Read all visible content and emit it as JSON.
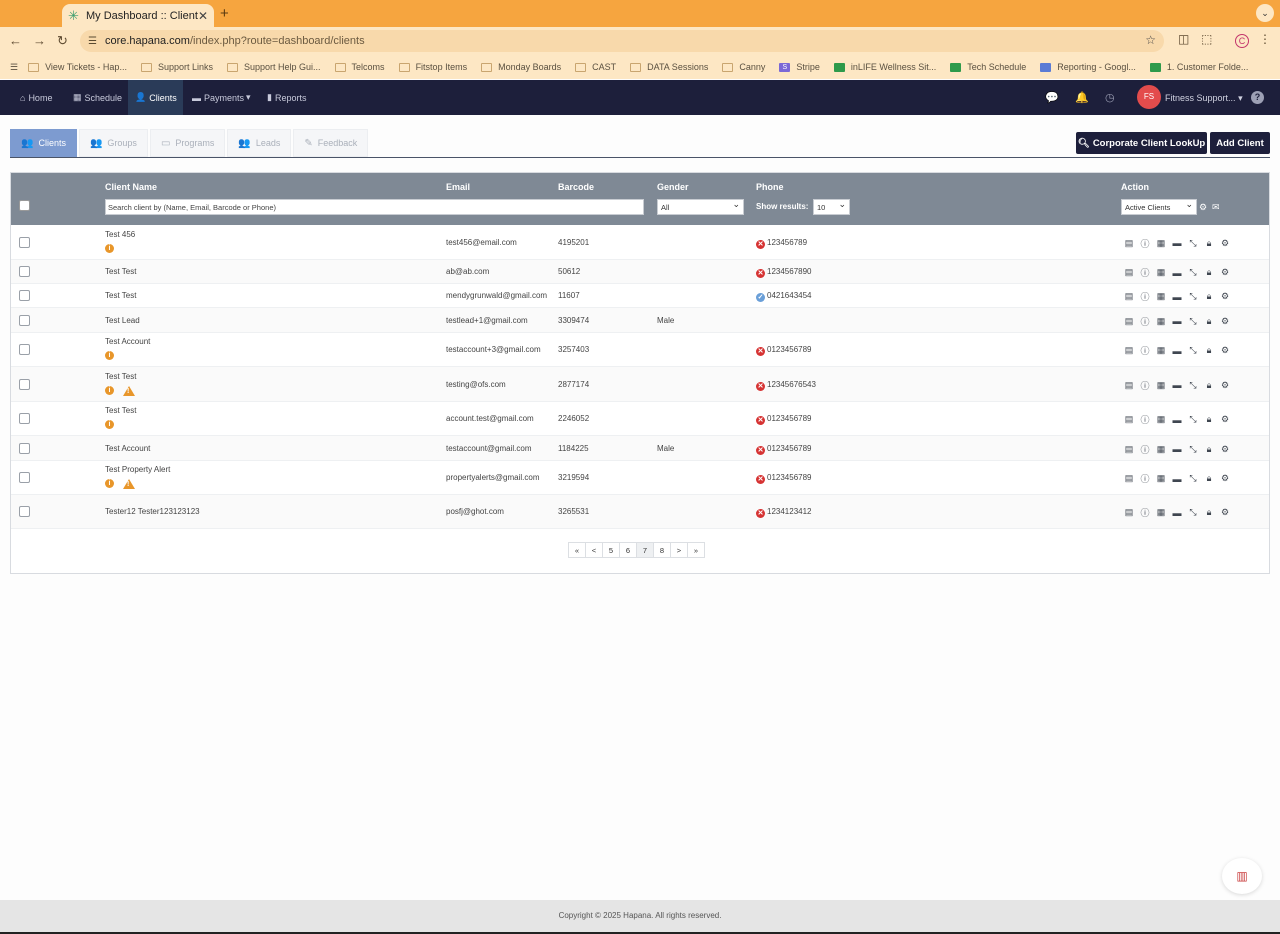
{
  "browser": {
    "tab_title": "My Dashboard :: Clients",
    "url_host": "core.hapana.com",
    "url_path": "/index.php?route=dashboard/clients",
    "profile_initial": "C"
  },
  "bookmarks": [
    {
      "label": "View Tickets - Hap...",
      "icon": "folder"
    },
    {
      "label": "Support Links",
      "icon": "folder"
    },
    {
      "label": "Support Help Gui...",
      "icon": "folder"
    },
    {
      "label": "Telcoms",
      "icon": "folder"
    },
    {
      "label": "Fitstop Items",
      "icon": "folder"
    },
    {
      "label": "Monday Boards",
      "icon": "folder"
    },
    {
      "label": "CAST",
      "icon": "folder"
    },
    {
      "label": "DATA Sessions",
      "icon": "folder"
    },
    {
      "label": "Canny",
      "icon": "folder"
    },
    {
      "label": "Stripe",
      "icon": "stripe"
    },
    {
      "label": "inLIFE Wellness Sit...",
      "icon": "sheets"
    },
    {
      "label": "Tech Schedule",
      "icon": "sheets"
    },
    {
      "label": "Reporting - Googl...",
      "icon": "docs"
    },
    {
      "label": "1. Customer Folde...",
      "icon": "drive"
    }
  ],
  "nav": {
    "home": "Home",
    "schedule": "Schedule",
    "clients": "Clients",
    "payments": "Payments",
    "reports": "Reports",
    "avatar_initials": "FS",
    "user_name": "Fitness Support..."
  },
  "subtabs": {
    "clients": "Clients",
    "groups": "Groups",
    "programs": "Programs",
    "leads": "Leads",
    "feedback": "Feedback"
  },
  "buttons": {
    "corporate_lookup": "Corporate Client LookUp",
    "add_client": "Add Client"
  },
  "table": {
    "headers": {
      "client_name": "Client Name",
      "email": "Email",
      "barcode": "Barcode",
      "gender": "Gender",
      "phone": "Phone",
      "action": "Action"
    },
    "search_placeholder": "Search client by (Name, Email, Barcode or Phone)",
    "gender_filter": "All",
    "show_results_label": "Show results:",
    "show_results_value": "10",
    "status_filter": "Active Clients",
    "rows": [
      {
        "name": "Test 456",
        "email": "test456@email.com",
        "barcode": "4195201",
        "gender": "",
        "phone": "123456789",
        "phone_status": "invalid",
        "info": true,
        "warn": false
      },
      {
        "name": "Test Test",
        "email": "ab@ab.com",
        "barcode": "50612",
        "gender": "",
        "phone": "1234567890",
        "phone_status": "invalid",
        "info": false,
        "warn": false
      },
      {
        "name": "Test Test",
        "email": "mendygrunwald@gmail.com",
        "barcode": "11607",
        "gender": "",
        "phone": "0421643454",
        "phone_status": "valid",
        "info": false,
        "warn": false
      },
      {
        "name": "Test Lead",
        "email": "testlead+1@gmail.com",
        "barcode": "3309474",
        "gender": "Male",
        "phone": "",
        "phone_status": "none",
        "info": false,
        "warn": false
      },
      {
        "name": "Test Account",
        "email": "testaccount+3@gmail.com",
        "barcode": "3257403",
        "gender": "",
        "phone": "0123456789",
        "phone_status": "invalid",
        "info": true,
        "warn": false
      },
      {
        "name": "Test Test",
        "email": "testing@ofs.com",
        "barcode": "2877174",
        "gender": "",
        "phone": "12345676543",
        "phone_status": "invalid",
        "info": true,
        "warn": true
      },
      {
        "name": "Test Test",
        "email": "account.test@gmail.com",
        "barcode": "2246052",
        "gender": "",
        "phone": "0123456789",
        "phone_status": "invalid",
        "info": true,
        "warn": false
      },
      {
        "name": "Test Account",
        "email": "testaccount@gmail.com",
        "barcode": "1184225",
        "gender": "Male",
        "phone": "0123456789",
        "phone_status": "invalid",
        "info": false,
        "warn": false
      },
      {
        "name": "Test Property Alert",
        "email": "propertyalerts@gmail.com",
        "barcode": "3219594",
        "gender": "",
        "phone": "0123456789",
        "phone_status": "invalid",
        "info": true,
        "warn": true
      },
      {
        "name": "Tester12 Tester123123123",
        "email": "posfj@ghot.com",
        "barcode": "3265531",
        "gender": "",
        "phone": "1234123412",
        "phone_status": "invalid",
        "info": false,
        "warn": false
      }
    ]
  },
  "pagination": {
    "first": "«",
    "prev": "<",
    "pages": [
      "5",
      "6",
      "7",
      "8"
    ],
    "current": "7",
    "next": ">",
    "last": "»"
  },
  "footer": "Copyright © 2025 Hapana. All rights reserved."
}
